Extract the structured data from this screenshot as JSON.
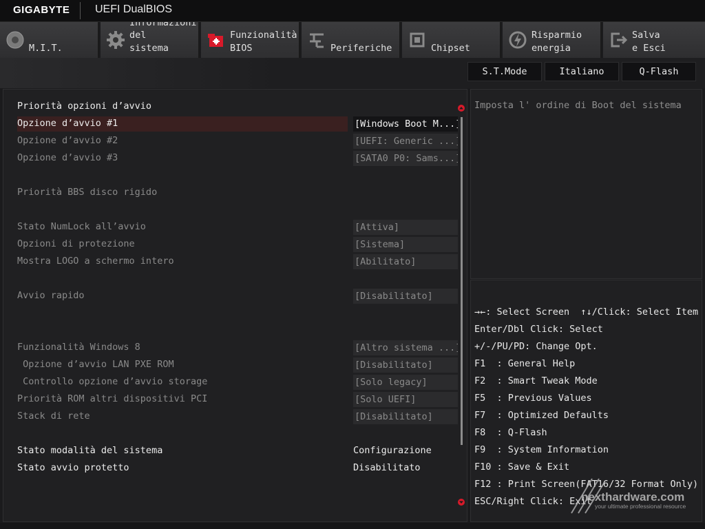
{
  "header": {
    "brand": "GIGABYTE",
    "bios_name": "UEFI DualBIOS"
  },
  "tabs": [
    {
      "icon": "mit-dial-icon",
      "lines": [
        "M.I.T."
      ],
      "active": false
    },
    {
      "icon": "gear-icon",
      "lines": [
        "Informazioni",
        "del",
        "sistema"
      ],
      "active": false
    },
    {
      "icon": "bios-chip-icon",
      "lines": [
        "Funzionalità",
        "BIOS"
      ],
      "active": true,
      "accent": "#d81a2a"
    },
    {
      "icon": "peripherals-icon",
      "lines": [
        "Periferiche"
      ],
      "active": false
    },
    {
      "icon": "chipset-icon",
      "lines": [
        "Chipset"
      ],
      "active": false
    },
    {
      "icon": "power-saving-icon",
      "lines": [
        "Risparmio",
        "energia"
      ],
      "active": false
    },
    {
      "icon": "exit-icon",
      "lines": [
        "Salva",
        "e Esci"
      ],
      "active": false
    }
  ],
  "quick_buttons": {
    "st_mode": "S.T.Mode",
    "language": "Italiano",
    "qflash": "Q-Flash"
  },
  "settings": {
    "heading": "Priorità opzioni d’avvio",
    "boot1": {
      "label": "Opzione d’avvio #1",
      "value": "[Windows Boot M...]"
    },
    "boot2": {
      "label": "Opzione d’avvio #2",
      "value": "[UEFI: Generic ...]"
    },
    "boot3": {
      "label": "Opzione d’avvio #3",
      "value": "[SATA0 P0: Sams...]"
    },
    "bbs": {
      "label": "Priorità BBS disco rigido"
    },
    "numlock": {
      "label": "Stato NumLock all’avvio",
      "value": "[Attiva]"
    },
    "security": {
      "label": "Opzioni di protezione",
      "value": "[Sistema]"
    },
    "logo": {
      "label": "Mostra LOGO a schermo intero",
      "value": "[Abilitato]"
    },
    "fastboot": {
      "label": "Avvio rapido",
      "value": "[Disabilitato]"
    },
    "win8": {
      "label": "Funzionalità Windows 8",
      "value": "[Altro sistema ...]"
    },
    "lanpxe": {
      "label": " Opzione d’avvio LAN PXE ROM",
      "value": "[Disabilitato]"
    },
    "storage": {
      "label": " Controllo opzione d’avvio storage",
      "value": "[Solo legacy]"
    },
    "pcirom": {
      "label": "Priorità ROM altri dispositivi PCI",
      "value": "[Solo UEFI]"
    },
    "netstack": {
      "label": "Stack di rete",
      "value": "[Disabilitato]"
    },
    "sysmode": {
      "label": "Stato modalità del sistema",
      "value": "Configurazione"
    },
    "secureboot": {
      "label": "Stato avvio protetto",
      "value": "Disabilitato"
    }
  },
  "help": {
    "text": "Imposta l' ordine di Boot del sistema"
  },
  "keys": [
    "→←: Select Screen  ↑↓/Click: Select Item",
    "Enter/Dbl Click: Select",
    "+/-/PU/PD: Change Opt.",
    "F1  : General Help",
    "F2  : Smart Tweak Mode",
    "F5  : Previous Values",
    "F7  : Optimized Defaults",
    "F8  : Q-Flash",
    "F9  : System Information",
    "F10 : Save & Exit",
    "F12 : Print Screen(FAT16/32 Format Only)",
    "ESC/Right Click: Exit"
  ],
  "watermark": {
    "text": "nexthardware.com",
    "tagline": "your ultimate professional resource"
  },
  "colors": {
    "accent": "#d81a2a",
    "selected_row": "#3a2020"
  }
}
